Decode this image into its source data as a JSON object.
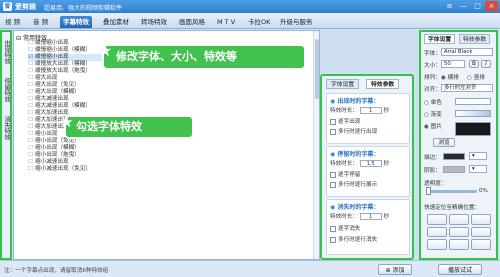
{
  "app": {
    "name": "爱剪辑",
    "slogan": "超易用、强大的视频剪辑软件"
  },
  "tabs": [
    "视 频",
    "音 频",
    "字幕特效",
    "叠加素材",
    "转场特效",
    "画面风格",
    "M T V",
    "卡拉OK",
    "升级与服务"
  ],
  "active_tab_index": 2,
  "vertical_tabs": [
    "出现特效",
    "停留特效",
    "消失特效"
  ],
  "list": {
    "header": "常用特效",
    "items": [
      "缓慢缩小出现",
      "缓慢缩小出现（模糊）",
      "缓慢缩小出现",
      "缓慢放大出现（模糊）",
      "缓慢放大出现（拖曳）",
      "缩大出现",
      "缩大出现（免见）",
      "缩大出现（模糊）",
      "缩大减速出现",
      "缩大减速出现（模糊）",
      "缩大加速出现",
      "缩大加速出现（模糊）",
      "缩大加速出现（拖曳）",
      "缩小出现",
      "缩小出现（免见）",
      "缩小出现（模糊）",
      "缩小出现（拖曳）",
      "缩小减速出现",
      "缩小减速出现（免见）"
    ],
    "selected_index": 2
  },
  "callouts": {
    "top": "修改字体、大小、特效等",
    "middle": "勾选字体特效"
  },
  "mid_panel": {
    "tabs": [
      "字体设置",
      "特效参数"
    ],
    "active_tab_index": 1,
    "appear": {
      "title": "出现时的字幕：",
      "duration_label": "特效时长：",
      "duration_value": "1",
      "unit": "秒",
      "option1": "逐字出现",
      "option2": "多行时逐行出现"
    },
    "stay": {
      "title": "停留时的字幕：",
      "duration_label": "特效时长：",
      "duration_value": "1.5",
      "unit": "秒",
      "option1": "逐字停留",
      "option2": "多行时逐行展示"
    },
    "disappear": {
      "title": "消失时的字幕：",
      "duration_label": "特效时长：",
      "duration_value": "1",
      "unit": "秒",
      "option1": "逐字消失",
      "option2": "多行时逐行消失"
    }
  },
  "right_panel": {
    "tabs": [
      "字体设置",
      "特效参数"
    ],
    "active_tab_index": 0,
    "font_label": "字体：",
    "font_value": "Arial Black",
    "size_label": "大小：",
    "size_value": "50",
    "align_label": "排列：",
    "align_h": "横排",
    "align_v": "竖排",
    "justify_label": "对齐：",
    "justify_value": "多行时左对齐",
    "color_label": "单色",
    "gradient_label": "渐变",
    "image_label": "图片",
    "browse_label": "浏览",
    "stroke_label": "描边：",
    "shadow_label": "阴影：",
    "opacity_label": "透明度：",
    "opacity_value": "0%",
    "quick_label": "快速定位至精确位置：",
    "stroke_color": "#2a2a2a",
    "image_preview_color": "#1a1a1a"
  },
  "status": {
    "tip": "注：一个字幕点出现，请留取消6种特效组",
    "add_button": "添加",
    "preview_button": "播放试试"
  }
}
